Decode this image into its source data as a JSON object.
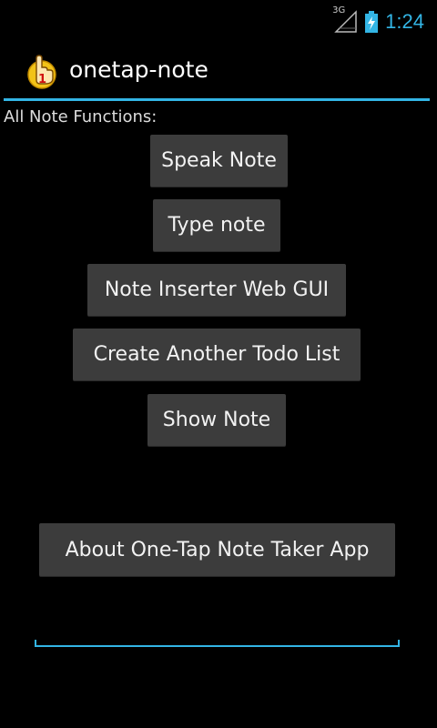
{
  "status_bar": {
    "network_type": "3G",
    "time": "1:24",
    "signal_icon": "signal-icon",
    "battery_icon": "battery-charging-icon"
  },
  "action_bar": {
    "app_icon": "pointing-hand-one-icon",
    "title": "onetap-note"
  },
  "main": {
    "section_label": "All Note Functions:",
    "buttons": [
      {
        "label": "Speak Note"
      },
      {
        "label": "Type note"
      },
      {
        "label": "Note Inserter Web GUI"
      },
      {
        "label": "Create Another Todo List"
      },
      {
        "label": "Show Note"
      }
    ],
    "about_button": {
      "label": "About One-Tap Note Taker App"
    },
    "note_input": {
      "value": "",
      "placeholder": ""
    }
  },
  "colors": {
    "accent": "#33b5e5",
    "button_bg": "#3c3c3c",
    "background": "#000000"
  }
}
